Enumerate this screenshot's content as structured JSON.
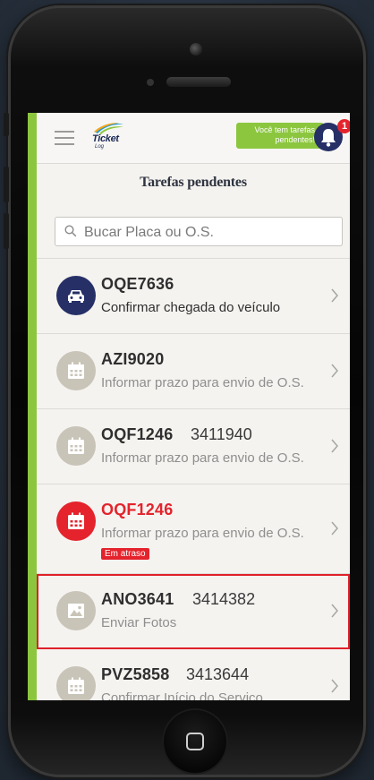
{
  "header": {
    "logo_text": "Ticket",
    "logo_sub": "Log",
    "pending_notice_line1": "Você tem tarefas",
    "pending_notice_line2": "pendentes!",
    "notification_count": "1"
  },
  "page": {
    "title": "Tarefas pendentes"
  },
  "search": {
    "placeholder": "Bucar Placa ou O.S."
  },
  "tasks": [
    {
      "plate": "OQE7636",
      "os": "",
      "description": "Confirmar chegada do veículo",
      "icon": "car-icon",
      "badge": ""
    },
    {
      "plate": "AZI9020",
      "os": "",
      "description": "Informar prazo para envio de O.S.",
      "icon": "calendar-icon",
      "badge": ""
    },
    {
      "plate": "OQF1246",
      "os": "3411940",
      "description": "Informar prazo para envio de O.S.",
      "icon": "calendar-icon",
      "badge": ""
    },
    {
      "plate": "OQF1246",
      "os": "",
      "description": "Informar prazo para envio de O.S.",
      "icon": "calendar-icon",
      "badge": "Em atraso"
    },
    {
      "plate": "ANO3641",
      "os": "3414382",
      "description": "Enviar Fotos",
      "icon": "photo-icon",
      "badge": ""
    },
    {
      "plate": "PVZ5858",
      "os": "3413644",
      "description": "Confirmar Início do Serviço",
      "icon": "calendar-icon",
      "badge": ""
    }
  ],
  "colors": {
    "accent_green": "#8cc63f",
    "navy": "#263067",
    "alert_red": "#e4232c",
    "highlight_outline": "#e0202a"
  }
}
